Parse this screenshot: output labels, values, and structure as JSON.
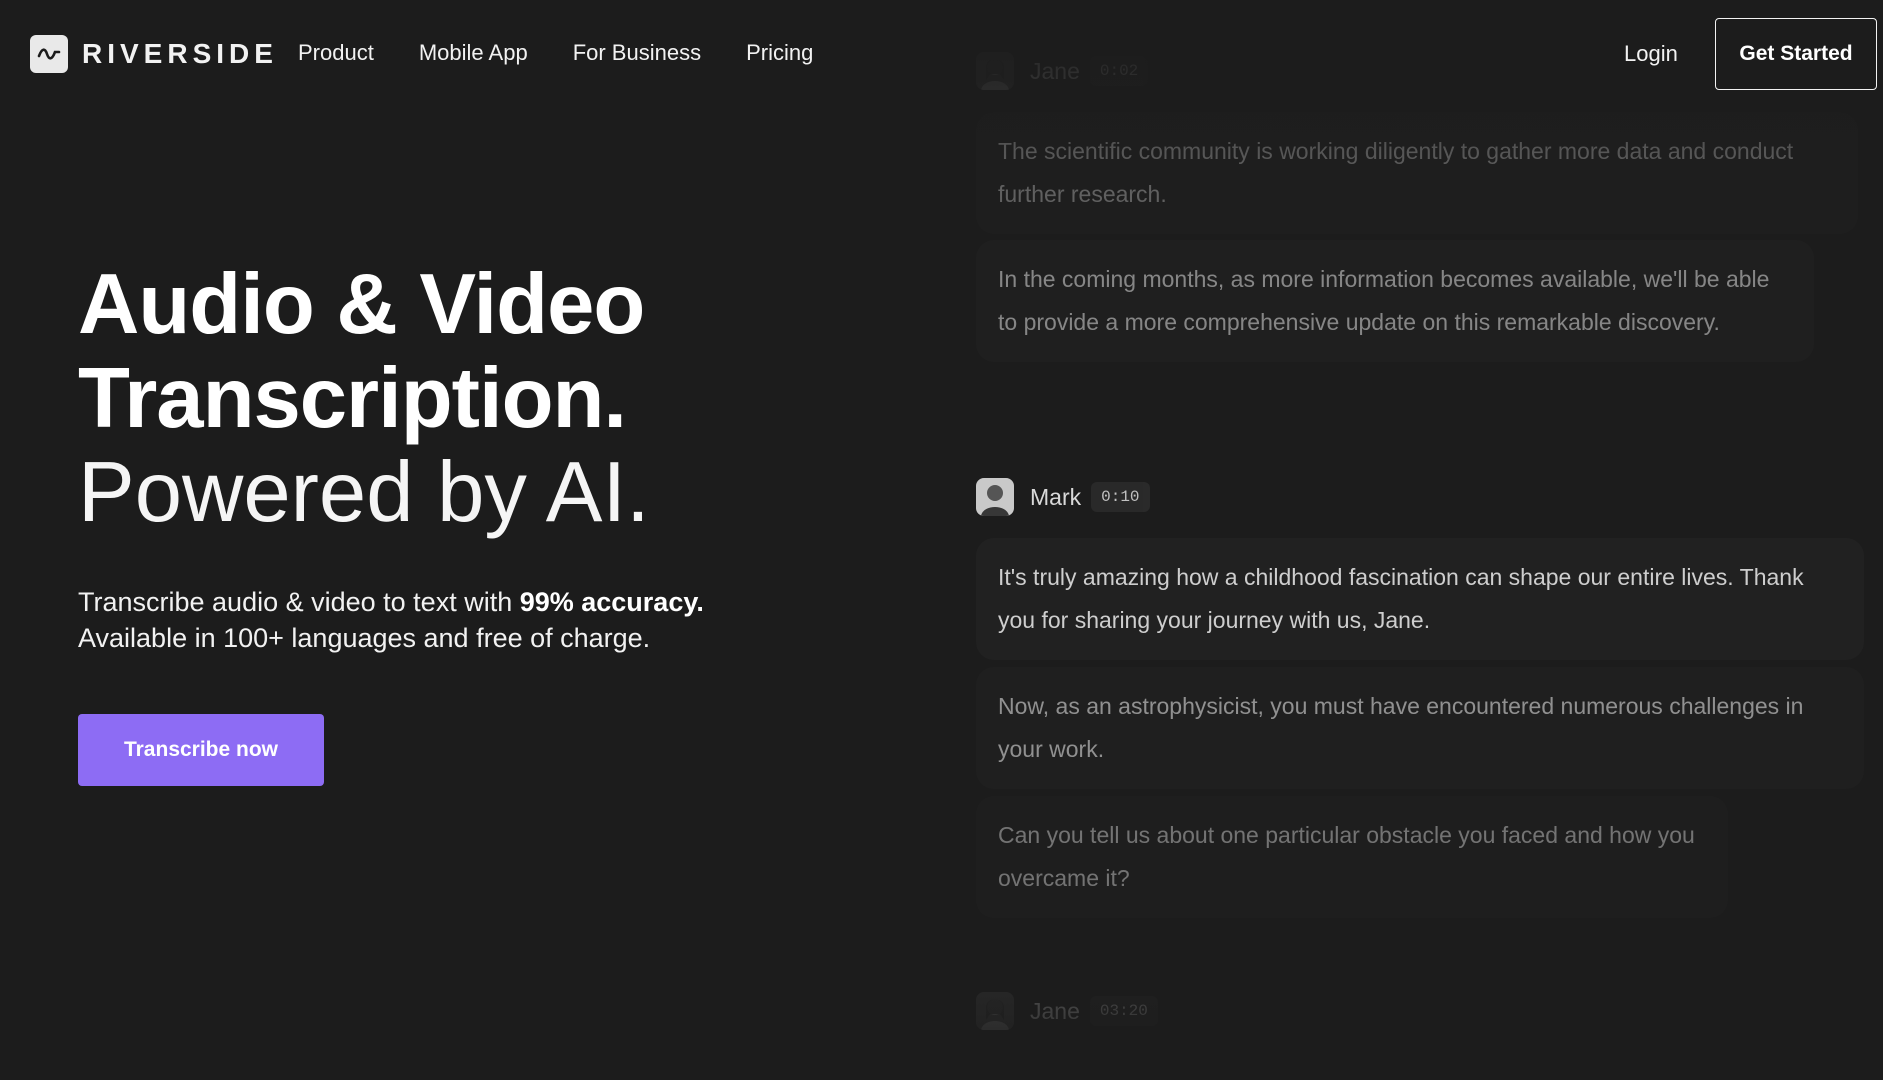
{
  "brand": {
    "name": "RIVERSIDE",
    "icon": "waveform-logo-icon"
  },
  "nav": {
    "links": [
      "Product",
      "Mobile App",
      "For Business",
      "Pricing"
    ],
    "login": "Login",
    "get_started": "Get Started"
  },
  "hero": {
    "line1": "Audio & Video",
    "line2": "Transcription.",
    "line3": "Powered by AI.",
    "sub_prefix": "Transcribe audio & video to text with ",
    "sub_bold": "99% accuracy.",
    "sub_line2": "Available in 100+ languages and free of charge.",
    "cta": "Transcribe now"
  },
  "transcript": {
    "blocks": [
      {
        "speaker": "Jane",
        "time": "0:02",
        "messages": [
          "The scientific community is working diligently to gather more data and conduct further research.",
          " In the coming months, as more information becomes available, we'll be able to provide a more comprehensive update on this remarkable discovery."
        ]
      },
      {
        "speaker": "Mark",
        "time": "0:10",
        "messages": [
          "It's truly amazing how a childhood fascination can shape our entire lives. Thank you for sharing your journey with us, Jane.",
          "Now, as an astrophysicist, you must have encountered numerous challenges in your work.",
          "Can you tell us about one particular obstacle you faced and how you overcame it?"
        ]
      },
      {
        "speaker": "Jane",
        "time": "03:20",
        "messages": []
      }
    ]
  },
  "colors": {
    "background": "#1c1c1c",
    "accent": "#8d6cf4",
    "bubble": "#222222"
  }
}
